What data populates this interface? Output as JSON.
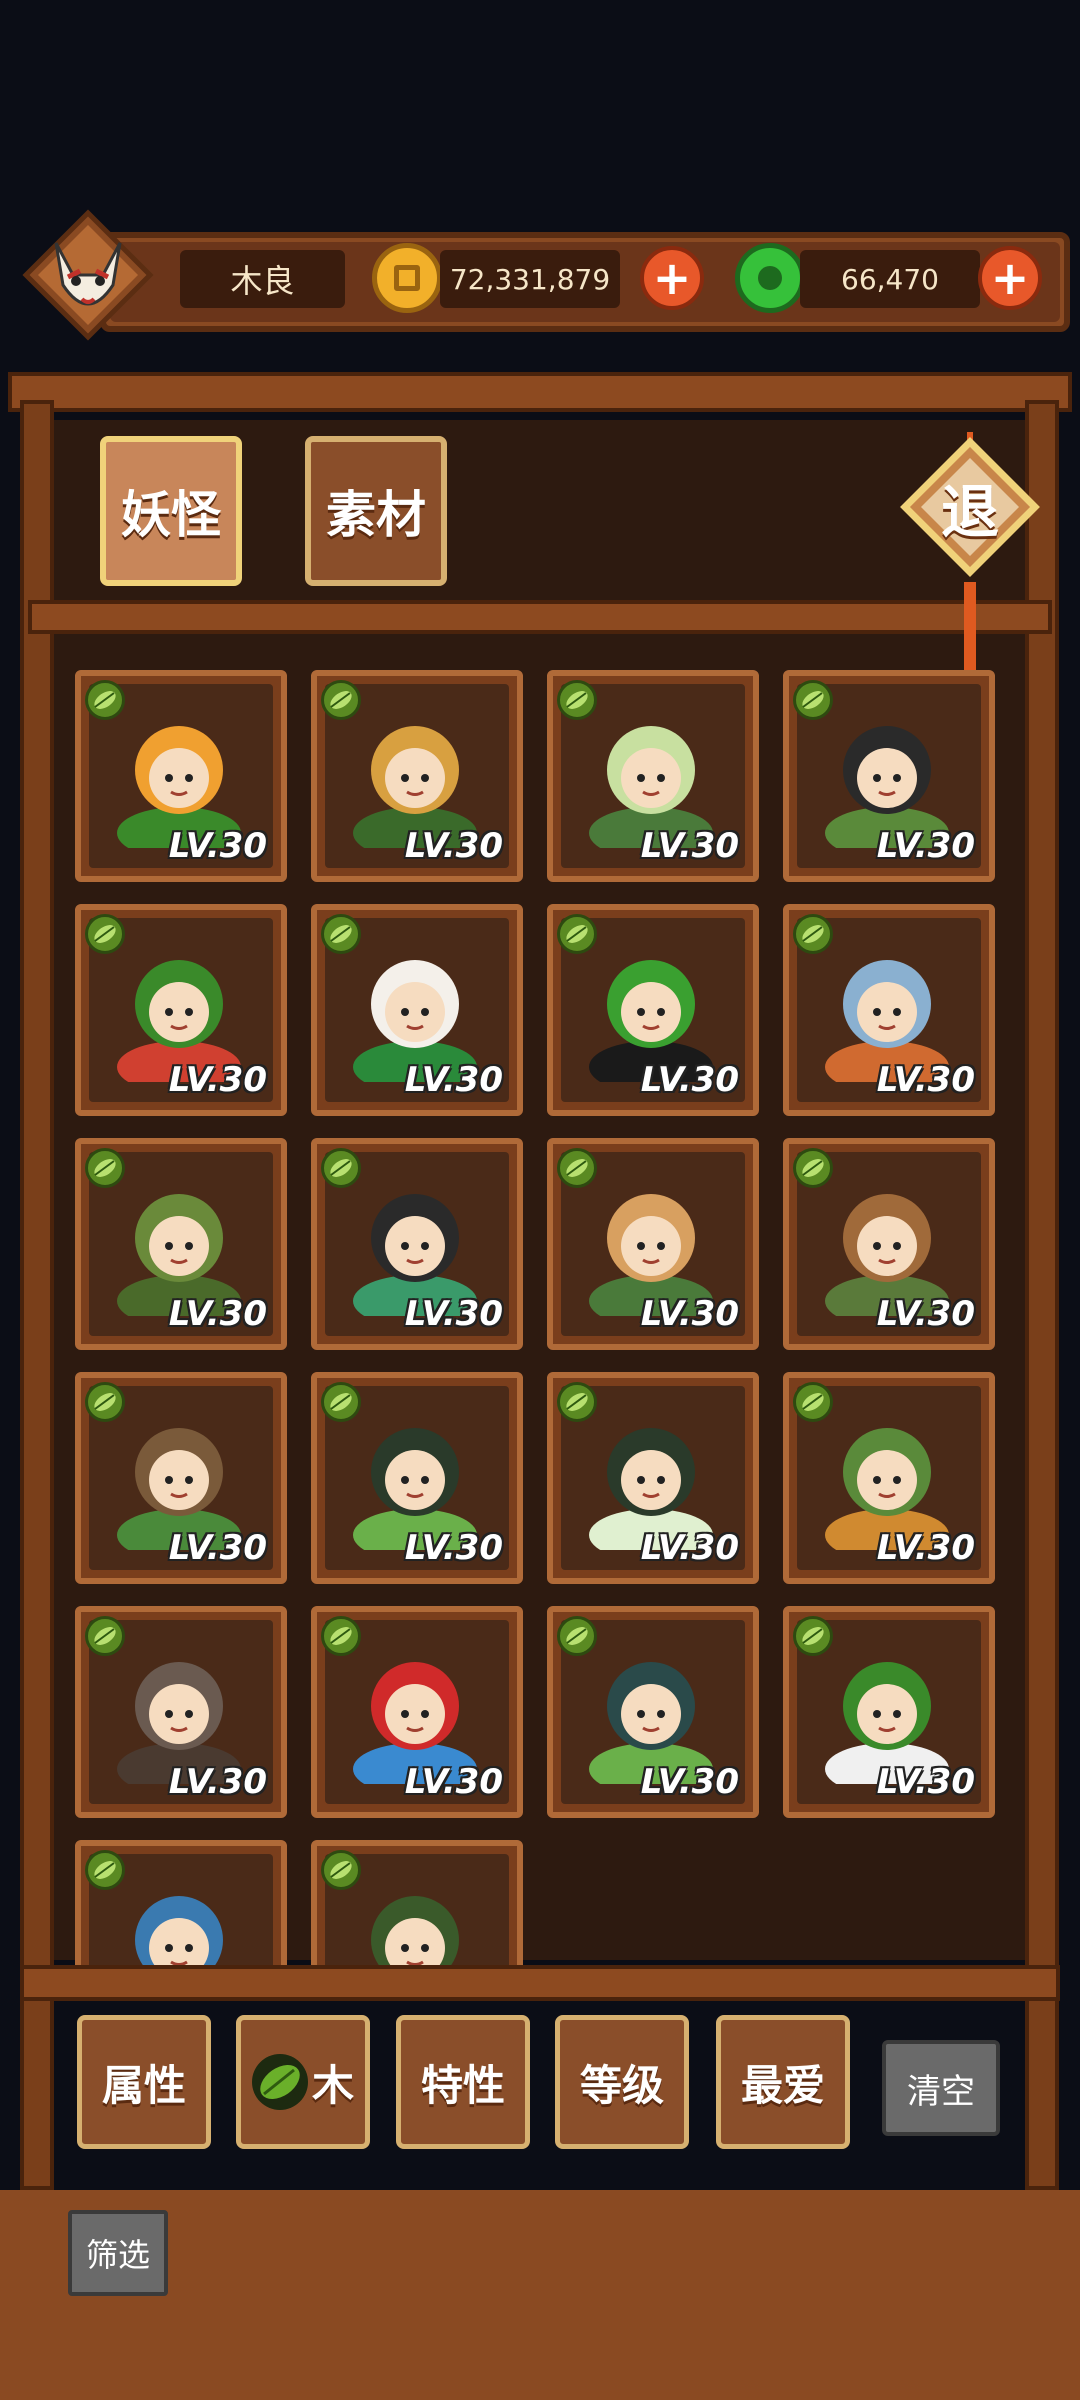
{
  "player": {
    "name": "木良"
  },
  "currencies": [
    {
      "name": "gold-coin",
      "value": "72,331,879",
      "color": "#f2b02a"
    },
    {
      "name": "jade",
      "value": "66,470",
      "color": "#36c13a"
    }
  ],
  "tabs": [
    {
      "label": "妖怪",
      "active": true
    },
    {
      "label": "素材",
      "active": false
    }
  ],
  "exit_label": "退",
  "cards": [
    {
      "name": "phoenix-bird",
      "level": "LV.30",
      "element": "leaf-icon"
    },
    {
      "name": "horned-helmet-warrior",
      "level": "LV.30",
      "element": "leaf-icon"
    },
    {
      "name": "white-haired-swordsman",
      "level": "LV.30",
      "element": "leaf-icon"
    },
    {
      "name": "bear-companion-girl",
      "level": "LV.30",
      "element": "leaf-icon"
    },
    {
      "name": "christmas-tree",
      "level": "LV.30",
      "element": "leaf-icon"
    },
    {
      "name": "white-beast-twins",
      "level": "LV.30",
      "element": "leaf-icon"
    },
    {
      "name": "frog-singer",
      "level": "LV.30",
      "element": "leaf-icon"
    },
    {
      "name": "moon-fan-spirit",
      "level": "LV.30",
      "element": "leaf-icon"
    },
    {
      "name": "moss-turtle",
      "level": "LV.30",
      "element": "leaf-icon"
    },
    {
      "name": "vine-girl",
      "level": "LV.30",
      "element": "leaf-icon"
    },
    {
      "name": "straw-hat-elder",
      "level": "LV.30",
      "element": "leaf-icon"
    },
    {
      "name": "stump-monk",
      "level": "LV.30",
      "element": "leaf-icon"
    },
    {
      "name": "wood-sprite-boy",
      "level": "LV.30",
      "element": "leaf-icon"
    },
    {
      "name": "green-kimono-girl",
      "level": "LV.30",
      "element": "leaf-icon"
    },
    {
      "name": "bamboo-maiden",
      "level": "LV.30",
      "element": "leaf-icon"
    },
    {
      "name": "smoke-monkey",
      "level": "LV.30",
      "element": "leaf-icon"
    },
    {
      "name": "walrus-beast",
      "level": "LV.30",
      "element": "leaf-icon"
    },
    {
      "name": "red-umbrella-demon",
      "level": "LV.30",
      "element": "leaf-icon"
    },
    {
      "name": "moss-ogre",
      "level": "LV.30",
      "element": "leaf-icon"
    },
    {
      "name": "coin-samurai",
      "level": "LV.30",
      "element": "leaf-icon"
    },
    {
      "name": "blue-mushroom-kid",
      "level": "",
      "element": "leaf-icon"
    },
    {
      "name": "bamboo-hat-monk",
      "level": "",
      "element": "leaf-icon"
    }
  ],
  "filters": [
    {
      "label": "属性",
      "icon": ""
    },
    {
      "label": "木",
      "icon": "leaf-icon"
    },
    {
      "label": "特性",
      "icon": ""
    },
    {
      "label": "等级",
      "icon": ""
    },
    {
      "label": "最爱",
      "icon": ""
    }
  ],
  "clear_label": "清空",
  "screen_label": "筛选"
}
